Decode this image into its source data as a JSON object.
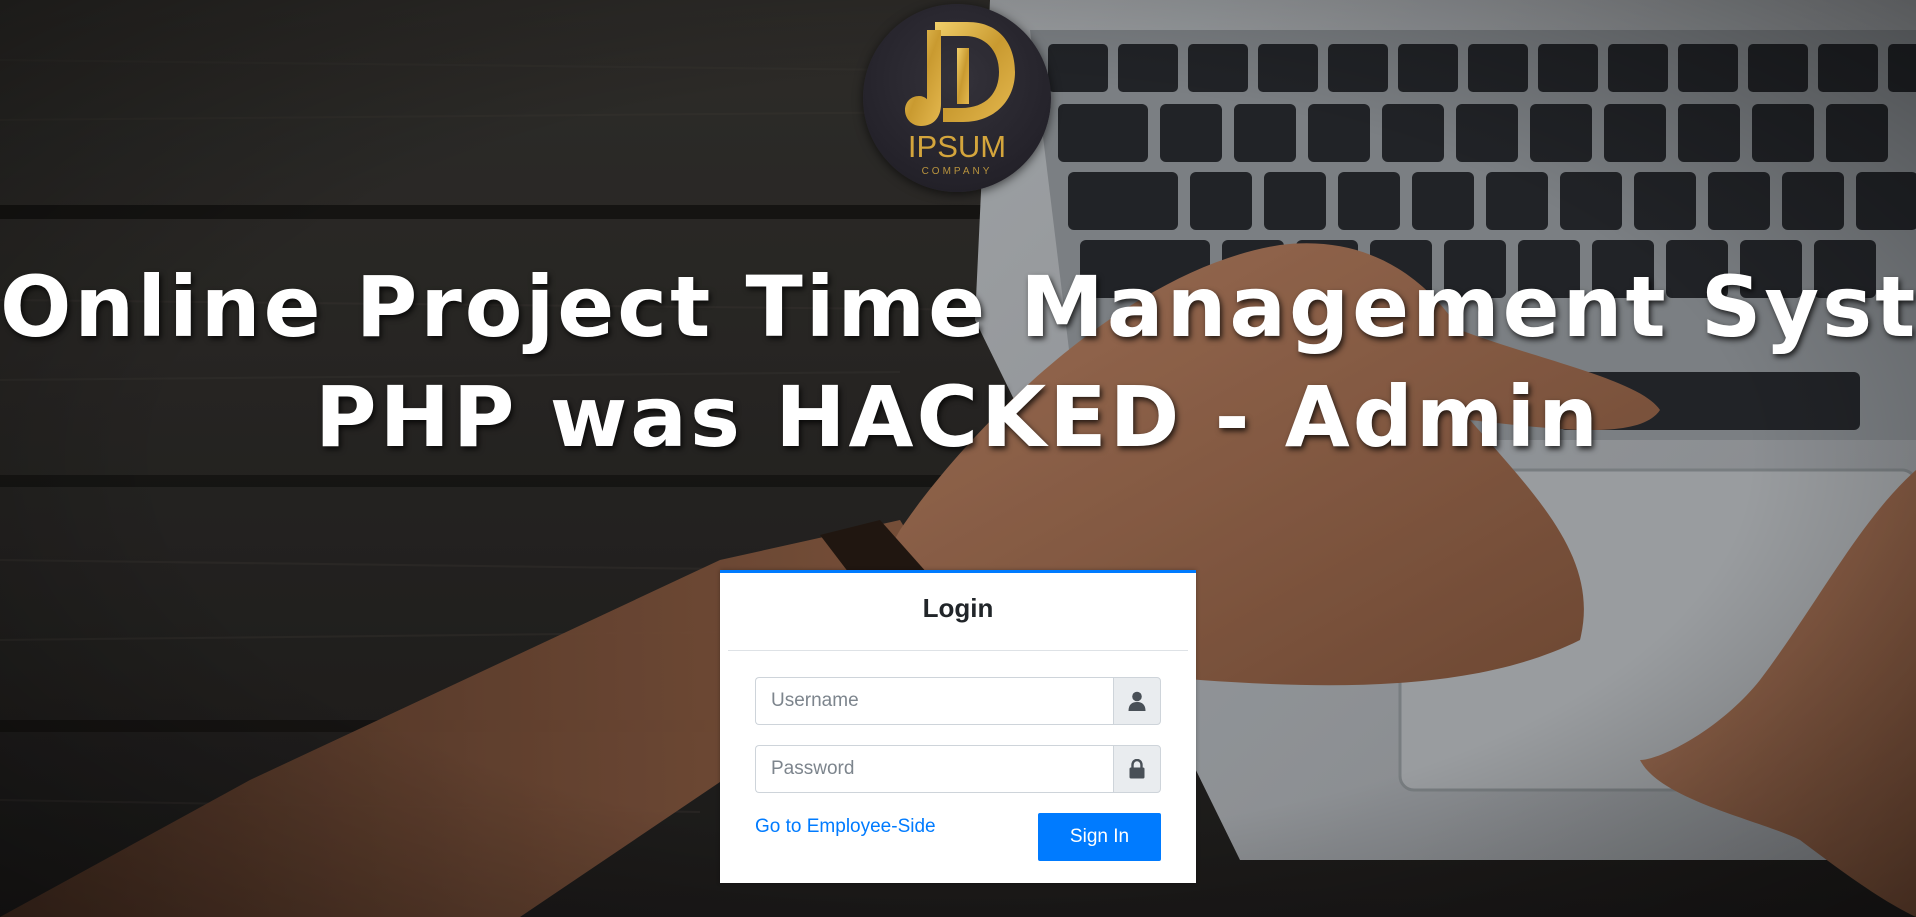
{
  "logo": {
    "word": "IPSUM",
    "sub": "COMPANY"
  },
  "title": {
    "line1": "Online Project Time Management System -",
    "line2": "PHP was HACKED - Admin"
  },
  "login": {
    "heading": "Login",
    "username_placeholder": "Username",
    "password_placeholder": "Password",
    "employee_link": "Go to Employee-Side",
    "signin_label": "Sign In"
  },
  "icons": {
    "username": "user-icon",
    "password": "lock-icon"
  },
  "colors": {
    "accent": "#007bff",
    "logo_gold": "#d4a53c"
  }
}
